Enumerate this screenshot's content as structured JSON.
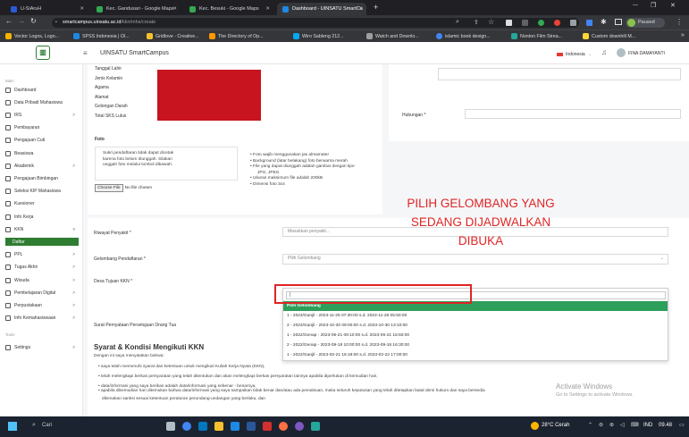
{
  "browser": {
    "tabs": [
      {
        "title": "U-SiAruH",
        "color": "#2a5bd7",
        "active": false
      },
      {
        "title": "Kec. Gandusari - Google Maps",
        "color": "#34a853",
        "active": false
      },
      {
        "title": "Kec. Besuki - Google Maps",
        "color": "#34a853",
        "active": false
      },
      {
        "title": "Dashboard - UINSATU SmartCa",
        "color": "#1e88e5",
        "active": true
      }
    ],
    "url_domain": "smartcampus.uinsatu.ac.id",
    "url_path": "/kkn/mhs/create",
    "paused_label": "Paused",
    "bookmarks": [
      "Vector Logos, Logo...",
      "SPSS Indonesia | Ol...",
      "Gridlove - Creative...",
      "The Directory of Op...",
      "Wiro Sableng 212...",
      "Watch and Downlo...",
      "islamic book design...",
      "Nonton Film Strea...",
      "Custom downhill M..."
    ]
  },
  "app": {
    "title": "UINSATU SmartCampus",
    "language": "Indonesia",
    "user": "FINA DAMAYANTI"
  },
  "sidebar": {
    "section_main": "Main",
    "section_tools": "Tools",
    "items": [
      {
        "label": "Dashboard",
        "chevron": ""
      },
      {
        "label": "Data Pribadi Mahasiswa",
        "chevron": ""
      },
      {
        "label": "IRS",
        "chevron": ">"
      },
      {
        "label": "Pembayaran",
        "chevron": ""
      },
      {
        "label": "Pengajuan Cuti",
        "chevron": ""
      },
      {
        "label": "Beasiswa",
        "chevron": ""
      },
      {
        "label": "Akademik",
        "chevron": ">"
      },
      {
        "label": "Pengajuan Bimbingan",
        "chevron": ""
      },
      {
        "label": "Seleksi KIP Mahasiswa",
        "chevron": ""
      },
      {
        "label": "Kuesioner",
        "chevron": ""
      },
      {
        "label": "Info Kerja",
        "chevron": ""
      },
      {
        "label": "KKN",
        "chevron": "v"
      },
      {
        "label": "Daftar",
        "chevron": ""
      },
      {
        "label": "PPL",
        "chevron": ">"
      },
      {
        "label": "Tugas Akhir",
        "chevron": ">"
      },
      {
        "label": "Wisuda",
        "chevron": ">"
      },
      {
        "label": "Pembelajaran Digital",
        "chevron": ">"
      },
      {
        "label": "Perpustakaan",
        "chevron": ">"
      },
      {
        "label": "Info Kemahasiswaan",
        "chevron": ">"
      },
      {
        "label": "Settings",
        "chevron": ">"
      }
    ]
  },
  "profile": {
    "fields": [
      "Tanggal Lahir",
      "Jenis Kelamin",
      "Agama",
      "Alamat",
      "Golongan Darah",
      "Total SKS Lulus"
    ],
    "foto_label": "Foto",
    "foto_warning": [
      "Sukri pendaftaran tidak dapat dicetak",
      "karena foto belum diunggah. Silakan",
      "unggah foto melalui tombol dibawah."
    ],
    "choose_file": "Choose File",
    "no_file": "No file chosen",
    "photo_rules": [
      "Foto wajib menggunakan jas almamater",
      "Background (latar belakang) foto berwarna merah",
      "File yang dapat diunggah adalah gambar dengan tipe",
      "JPG, JPEG",
      "Ukuran maksimum file adalah 200kB",
      "Dimensi foto 3x4"
    ],
    "hubungan_label": "Hubungan *"
  },
  "form": {
    "riwayat_label": "Riwayat Penyakit *",
    "riwayat_placeholder": "Masukkan penyakit...",
    "gelombang_label": "Gelombang Pendaftaran *",
    "gelombang_value": "Pilih Gelombang",
    "desa_label": "Desa Tujuan KKN *",
    "surat_label": "Surat Pernyataan Persetujuan Orang Tua"
  },
  "dropdown": {
    "search_value": "|",
    "options": [
      "Pilih Gelombang",
      "1 - 2023/Ganjil - 2023-11-25 07:30:00 s.d. 2023-11-28 05:50:00",
      "2 - 2023/Ganjil - 2023-10-30 09:00:00 s.d. 2023-10-30 13:10:00",
      "1 - 2022/Genap - 2023-06-21 09:10:00 s.d. 2023-06-21 16:60:00",
      "2 - 2022/Genap - 2023-09-18 10:00:00 s.d. 2023-09-18 16:30:00",
      "1 - 2022/Ganjil - 2023-02-21 16:18:00 s.d. 2023-02-22 17:00:00"
    ],
    "highlight_color": "#2e9f5b"
  },
  "annotation": {
    "line1": "PILIH GELOMBANG YANG",
    "line2": "SEDANG DIJADWALKAN",
    "line3": "DIBUKA",
    "color": "#e02424"
  },
  "terms": {
    "heading": "Syarat & Kondisi Mengikuti KKN",
    "intro": "Dengan ini saya menyatakan bahwa:",
    "items": [
      "saya telah memenuhi syarat dan ketentuan untuk mengikuti Kuliah Kerja Nyata (KKN),",
      "telah melengkapi berkas persyaratan yang telah ditentukan dan akan melengkapi berkas persyaratan lainnya apabila diperlukan di kemudian hari,",
      "data/informasi yang saya berikan adalah data/informasi yang sebenar - benarnya,",
      "apabila dikemudian hari ditemukan bahwa data/informasi yang saya sampaikan tidak benar dan/atau ada pemalsuan, maka seluruh keputusan yang telah ditetapkan batal demi hukum dan saya bersedia",
      "dikenakan sanksi sesuai ketentuan peraturan perundang-undangan yang berlaku, dan"
    ]
  },
  "watermark": {
    "title": "Activate Windows",
    "subtitle": "Go to Settings to activate Windows."
  },
  "taskbar": {
    "search": "Cari",
    "weather": "28°C Cerah",
    "lang": "IND",
    "time": "09.48"
  }
}
